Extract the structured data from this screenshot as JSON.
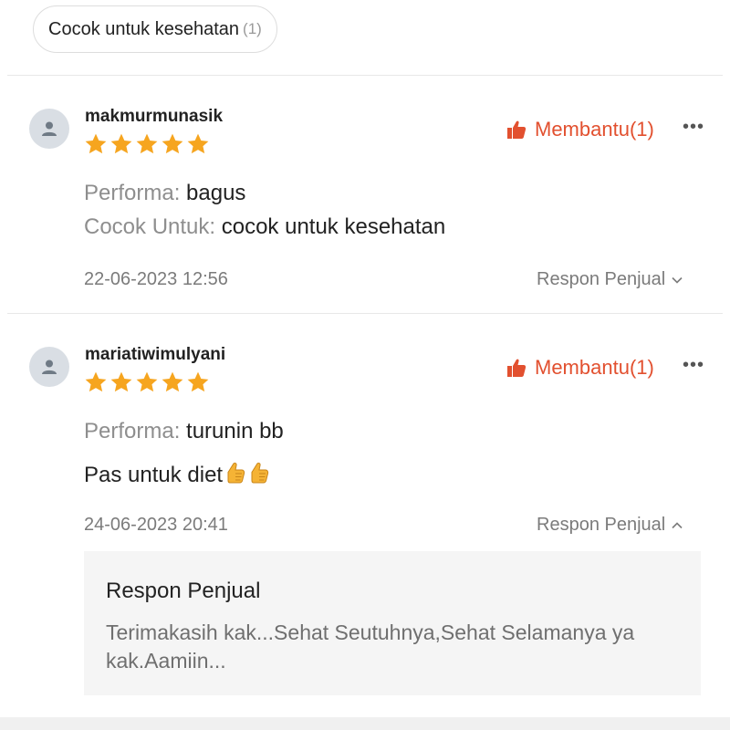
{
  "filter_chip": {
    "label": "Cocok untuk kesehatan",
    "count": "(1)"
  },
  "colors": {
    "accent": "#e2502f",
    "star": "#f6a51f",
    "muted": "#8e8e8e"
  },
  "reviews": [
    {
      "username": "makmurmunasik",
      "rating": 5,
      "helpful_label": "Membantu(1)",
      "more_icon": "more-dots-icon",
      "lines": [
        {
          "label": "Performa: ",
          "value": "bagus"
        },
        {
          "label": "Cocok Untuk: ",
          "value": "cocok untuk kesehatan"
        }
      ],
      "date": "22-06-2023 12:56",
      "respon_toggle": "Respon Penjual",
      "respon_expanded": false
    },
    {
      "username": "mariatiwimulyani",
      "rating": 5,
      "helpful_label": "Membantu(1)",
      "more_icon": "more-dots-icon",
      "lines": [
        {
          "label": "Performa: ",
          "value": "turunin bb"
        }
      ],
      "comment": "Pas untuk diet",
      "comment_emoji": "thumbs-up-icon",
      "date": "24-06-2023 20:41",
      "respon_toggle": "Respon Penjual",
      "respon_expanded": true,
      "seller_reply": {
        "title": "Respon Penjual",
        "text": "Terimakasih kak...Sehat Seutuhnya,Sehat Selamanya ya kak.Aamiin..."
      }
    }
  ]
}
